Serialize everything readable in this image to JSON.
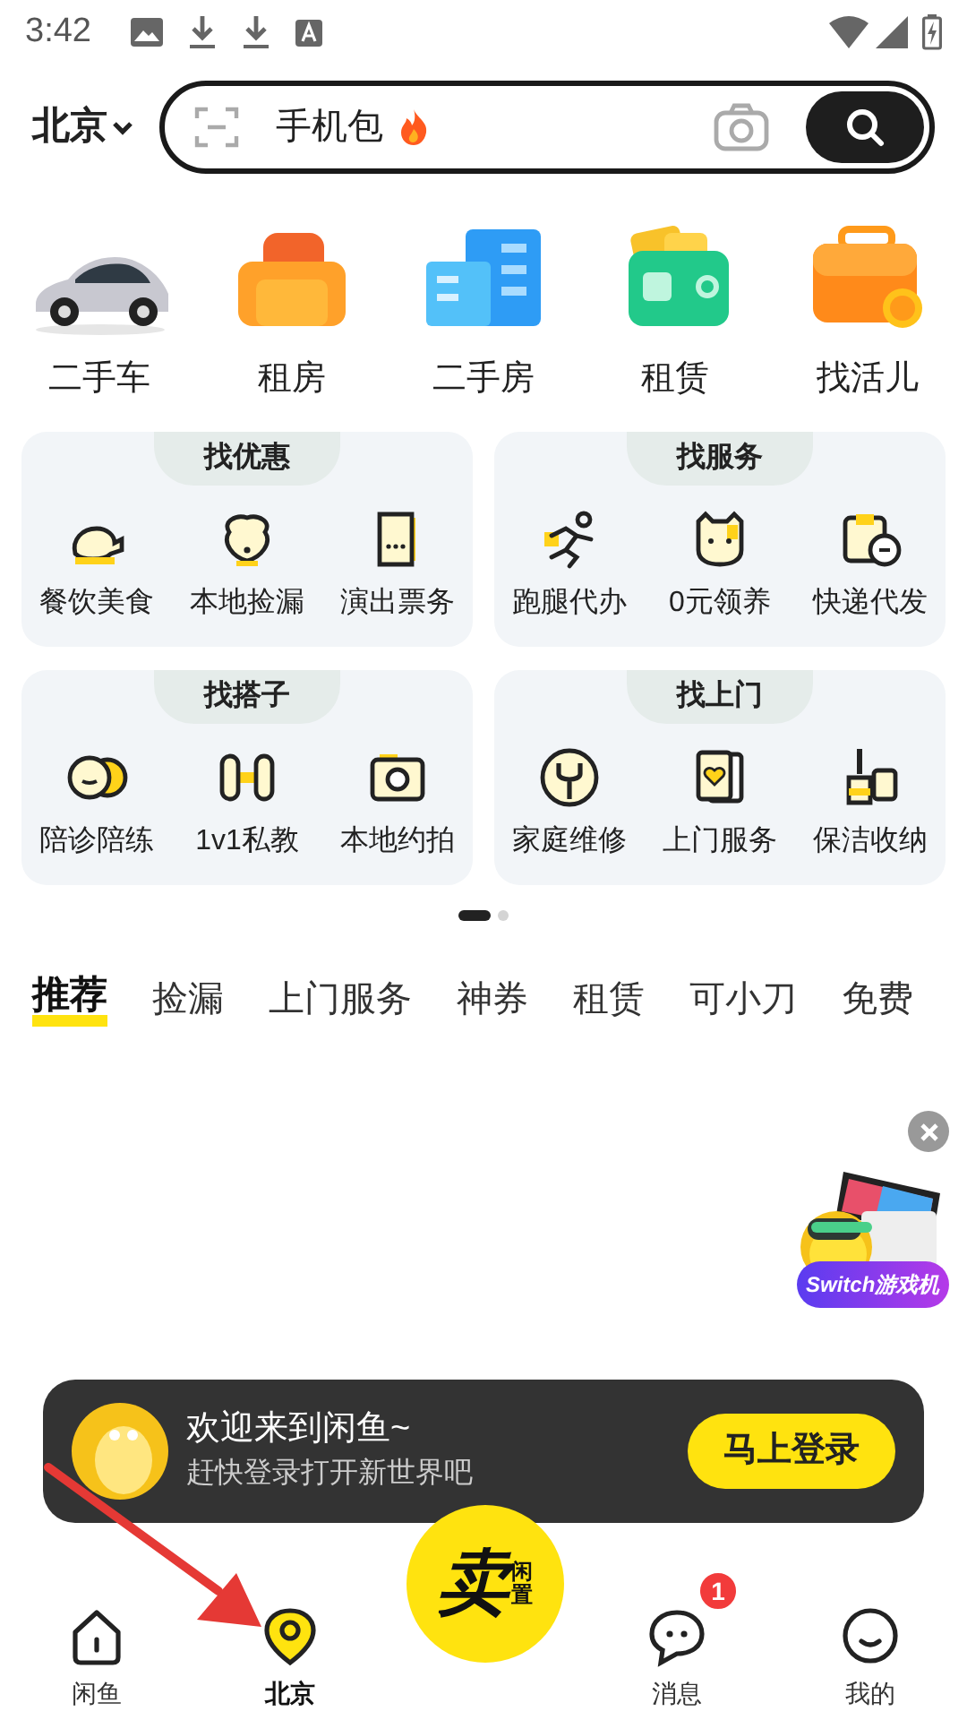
{
  "status_bar": {
    "time": "3:42"
  },
  "header": {
    "city": "北京",
    "search": {
      "placeholder": "手机包"
    }
  },
  "categories": [
    {
      "label": "二手车"
    },
    {
      "label": "租房"
    },
    {
      "label": "二手房"
    },
    {
      "label": "租赁"
    },
    {
      "label": "找活儿"
    }
  ],
  "service_cards": [
    {
      "title": "找优惠",
      "items": [
        {
          "label": "餐饮美食"
        },
        {
          "label": "本地捡漏"
        },
        {
          "label": "演出票务"
        }
      ]
    },
    {
      "title": "找服务",
      "items": [
        {
          "label": "跑腿代办"
        },
        {
          "label": "0元领养"
        },
        {
          "label": "快递代发"
        }
      ]
    },
    {
      "title": "找搭子",
      "items": [
        {
          "label": "陪诊陪练"
        },
        {
          "label": "1v1私教"
        },
        {
          "label": "本地约拍"
        }
      ]
    },
    {
      "title": "找上门",
      "items": [
        {
          "label": "家庭维修"
        },
        {
          "label": "上门服务"
        },
        {
          "label": "保洁收纳"
        }
      ]
    }
  ],
  "pager": [
    {
      "selected": true
    },
    {
      "selected": false
    }
  ],
  "feed_tabs": [
    {
      "label": "推荐",
      "selected": true
    },
    {
      "label": "捡漏",
      "selected": false
    },
    {
      "label": "上门服务",
      "selected": false
    },
    {
      "label": "神券",
      "selected": false
    },
    {
      "label": "租赁",
      "selected": false
    },
    {
      "label": "可小刀",
      "selected": false
    },
    {
      "label": "免费",
      "selected": false
    }
  ],
  "floating_ad": {
    "label": "Switch游戏机"
  },
  "login_banner": {
    "title": "欢迎来到闲鱼~",
    "subtitle": "赶快登录打开新世界吧",
    "button": "马上登录"
  },
  "bottom_nav": [
    {
      "kind": "tab",
      "label": "闲鱼",
      "selected": false
    },
    {
      "kind": "tab",
      "label": "北京",
      "selected": true
    },
    {
      "kind": "sell",
      "label": "卖",
      "sublabel": "闲置",
      "selected": false
    },
    {
      "kind": "tab",
      "label": "消息",
      "selected": false,
      "badge": "1"
    },
    {
      "kind": "tab",
      "label": "我的",
      "selected": false
    }
  ]
}
